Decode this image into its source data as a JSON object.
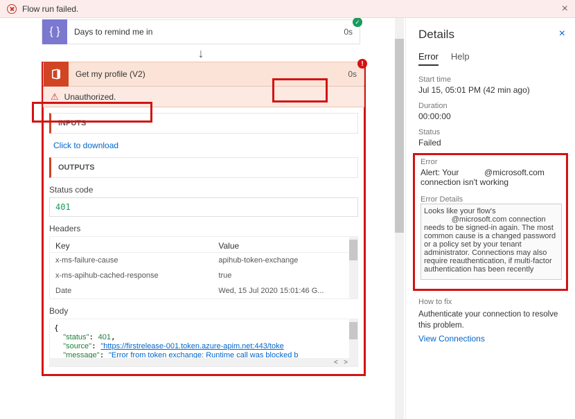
{
  "alert": {
    "text": "Flow run failed."
  },
  "steps": {
    "s1": {
      "label": "Days to remind me in",
      "timing": "0s"
    },
    "s2": {
      "label": "Get my profile (V2)",
      "timing": "0s",
      "error": "Unauthorized."
    }
  },
  "inputs": {
    "heading": "INPUTS",
    "download": "Click to download"
  },
  "outputs": {
    "heading": "OUTPUTS",
    "status_label": "Status code",
    "status_code": "401",
    "headers_label": "Headers",
    "kv_head_k": "Key",
    "kv_head_v": "Value",
    "headers": [
      {
        "k": "x-ms-failure-cause",
        "v": "apihub-token-exchange"
      },
      {
        "k": "x-ms-apihub-cached-response",
        "v": "true"
      },
      {
        "k": "Date",
        "v": "Wed, 15 Jul 2020 15:01:46 G..."
      }
    ],
    "body_label": "Body",
    "body_json": {
      "status_key": "\"status\"",
      "status_val": "401",
      "source_key": "\"source\"",
      "source_val": "\"https://firstrelease-001.token.azure-apim.net:443/toke",
      "message_key": "\"message\"",
      "message_val": "\"Error from token exchange: Runtime call was blocked b"
    }
  },
  "details": {
    "title": "Details",
    "tabs": {
      "error": "Error",
      "help": "Help"
    },
    "start_l": "Start time",
    "start_v": "Jul 15, 05:01 PM (42 min ago)",
    "dur_l": "Duration",
    "dur_v": "00:00:00",
    "status_l": "Status",
    "status_v": "Failed",
    "error_l": "Error",
    "error_v": "Alert: Your           @microsoft.com connection isn't working",
    "errdet_l": "Error Details",
    "errdet_v": "Looks like your flow's\n             @microsoft.com connection needs to be signed-in again. The most common cause is a changed password or a policy set by your tenant administrator. Connections may also require reauthentication, if multi-factor authentication has been recently",
    "fix_l": "How to fix",
    "fix_v": "Authenticate your connection to resolve this problem.",
    "view_conn": "View Connections"
  }
}
